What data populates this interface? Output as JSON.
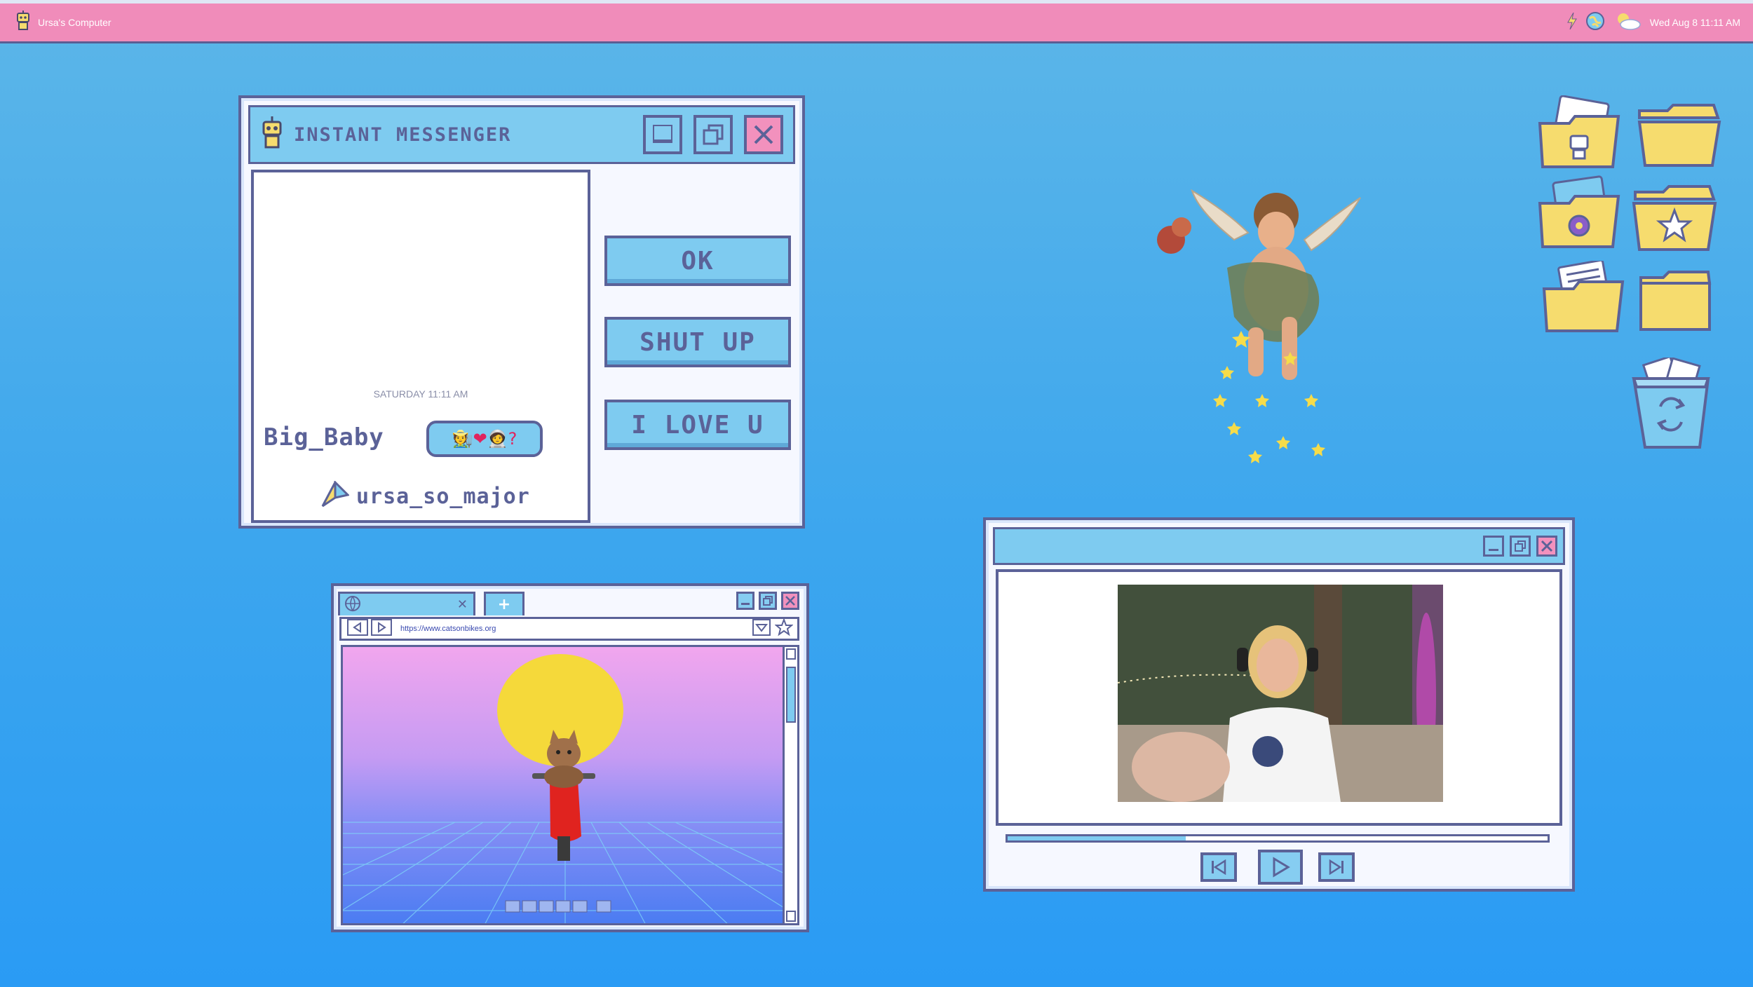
{
  "topbar": {
    "computer_name": "Ursa's Computer",
    "datetime": "Wed Aug 8 11:11 AM",
    "icons": [
      "robot-icon",
      "lightning-icon",
      "globe-icon",
      "weather-icon"
    ]
  },
  "messenger": {
    "title": "INSTANT MESSENGER",
    "timestamp": "SATURDAY 11:11 AM",
    "sender": "Big_Baby",
    "message_emojis": "🧑‍🌾❤🧑‍🚀?",
    "user": "ursa_so_major",
    "buttons": [
      "OK",
      "SHUT UP",
      "I LOVE U"
    ]
  },
  "browser": {
    "tab_close": "✕",
    "new_tab": "+",
    "url": "https://www.catsonbikes.org"
  },
  "video_player": {
    "progress": 0.33
  },
  "desktop_icons": [
    "robot-folder",
    "folder",
    "flower-folder",
    "star-folder",
    "document-folder",
    "folder",
    "recycle-bin"
  ],
  "colors": {
    "desktop": "#3ca6ee",
    "topbar": "#f08cba",
    "window_border": "#5b6298",
    "titlebar": "#7ecbf0",
    "close_button": "#f291bd",
    "folder": "#f6dc6e"
  }
}
